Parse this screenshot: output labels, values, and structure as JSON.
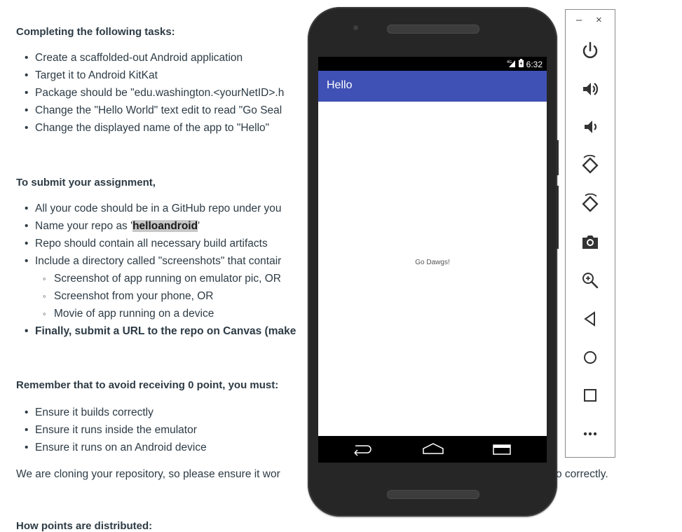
{
  "doc": {
    "section1_heading": "Completing the following tasks:",
    "section1_items": [
      "Create a scaffolded-out Android application",
      "Target it to Android KitKat",
      "Package should be \"edu.washington.<yourNetID>.h",
      "Change the \"Hello World\" text edit to read \"Go Seal",
      "Change the displayed name of the app to \"Hello\""
    ],
    "section2_heading": "To submit your assignment,",
    "section2_items": {
      "code_repo": "All your code should be in a GitHub repo under you",
      "name_repo_prefix": "Name your repo as '",
      "name_repo_highlight": "helloandroid",
      "name_repo_suffix": "'",
      "artifacts": "Repo should contain all necessary build artifacts",
      "screenshots_dir": "Include a directory called \"screenshots\" that contair",
      "sub_items": [
        "Screenshot of app running on emulator pic, OR",
        "Screenshot from your phone, OR",
        "Movie of app running on a device"
      ],
      "submit_url": "Finally, submit a URL to the repo on Canvas (make"
    },
    "section3_heading": "Remember that to avoid receiving 0 point, you must:",
    "section3_items": [
      "Ensure it builds correctly",
      "Ensure it runs inside the emulator",
      "Ensure it runs on an Android device"
    ],
    "closing_left": "We are cloning your repository, so please ensure it wor",
    "closing_right": "o correctly.",
    "partial_heading": "How points are distributed:"
  },
  "phone": {
    "status_time": "6:32",
    "status_network": "4G",
    "app_title": "Hello",
    "main_text": "Go Dawgs!",
    "frame_color": "#262626",
    "appbar_color": "#3f51b5"
  },
  "toolbar": {
    "minimize_label": "–",
    "close_label": "×",
    "tools": [
      "power-icon",
      "volume-up-icon",
      "volume-down-icon",
      "rotate-left-icon",
      "rotate-right-icon",
      "camera-icon",
      "zoom-icon",
      "back-icon",
      "home-icon",
      "overview-icon",
      "more-icon"
    ]
  }
}
